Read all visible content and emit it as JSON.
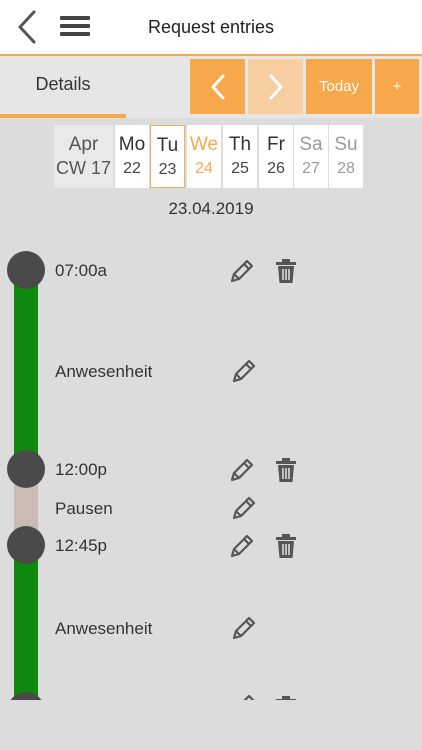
{
  "header": {
    "title": "Request entries"
  },
  "toolbar": {
    "details_tab": "Details",
    "today_label": "Today",
    "add_label": "+"
  },
  "week": {
    "month": "Apr",
    "cw": "CW 17",
    "days": [
      {
        "name": "Mo",
        "num": "22"
      },
      {
        "name": "Tu",
        "num": "23"
      },
      {
        "name": "We",
        "num": "24"
      },
      {
        "name": "Th",
        "num": "25"
      },
      {
        "name": "Fr",
        "num": "26"
      },
      {
        "name": "Sa",
        "num": "27"
      },
      {
        "name": "Su",
        "num": "28"
      }
    ]
  },
  "date_label": "23.04.2019",
  "entries": [
    {
      "time": "07:00a"
    },
    {
      "type": "Anwesenheit"
    },
    {
      "time": "12:00p"
    },
    {
      "type": "Pausen"
    },
    {
      "time": "12:45p"
    },
    {
      "type": "Anwesenheit"
    }
  ],
  "colors": {
    "accent": "#f7a84a",
    "presence": "#0f8a0f",
    "pause": "#cbbcb3",
    "marker": "#4a4a4a"
  },
  "icons": {
    "back": "chevron-left-icon",
    "menu": "hamburger-menu-icon",
    "edit": "pencil-icon",
    "delete": "trash-icon"
  }
}
